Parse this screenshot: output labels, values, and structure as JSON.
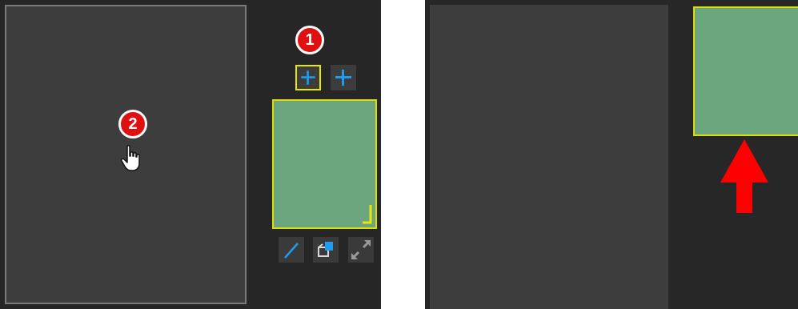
{
  "annotations": {
    "step1": "1",
    "step2": "2"
  },
  "colors": {
    "background": "#262626",
    "canvas": "#3d3d3d",
    "thumbnail_fill": "#6ba67e",
    "selection_outline": "#dede00",
    "plus_icon": "#1f9bf0",
    "badge": "#e01010",
    "arrow": "#ff0000"
  },
  "icons": {
    "add_button_1": "plus-icon",
    "add_button_2": "plus-icon",
    "edit_tool": "pencil-icon",
    "clone_tool": "clone-icon",
    "expand_tool": "expand-icon",
    "cursor": "hand-pointer-icon",
    "direction": "arrow-up-icon"
  }
}
